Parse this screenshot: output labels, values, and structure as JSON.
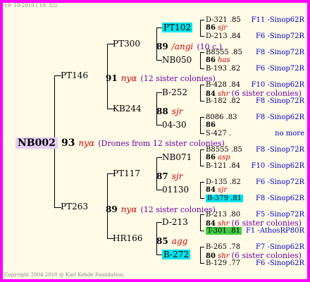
{
  "header": {
    "date": "19- 10-2010 ( 10: 32)"
  },
  "footer": {
    "copyright": "Copyright 2004-2010 @ Karl Kehde Foundation."
  },
  "root": {
    "id": "NB002",
    "gen": "93",
    "race": "nyα",
    "note": "(Drones from 12 sister colonies)"
  },
  "mother": {
    "id": "PT146",
    "gen": "91",
    "race": "nyα",
    "note": "(12 sister colonies)",
    "pt300": {
      "id": "PT300",
      "gen": "89",
      "race": "/angi",
      "note": "(10 c.)",
      "pt102": "PT102",
      "nb050": "NB050",
      "pt102_s": {
        "gen": "86",
        "race": "sjr"
      },
      "nb050_s": {
        "gen": "86",
        "race": "has"
      }
    },
    "kb244": {
      "id": "KB244",
      "gen": "88",
      "race": "sjr",
      "b252": "B-252",
      "n0430": "04-30",
      "b252_s": {
        "gen": "84",
        "race": "shr",
        "note": "(6 sister colonies)"
      },
      "n0430_s": {
        "gen": "86"
      }
    }
  },
  "father": {
    "id": "PT263",
    "gen": "89",
    "race": "nyα",
    "note": "(12 sister colonies)",
    "pt117": {
      "id": "PT117",
      "gen": "87",
      "race": "sjr",
      "nb071": "NB071",
      "n01130": "01130",
      "nb071_s": {
        "gen": "86",
        "race": "asp"
      },
      "n01130_s": {
        "gen": "84",
        "race": "sjr"
      }
    },
    "hr166": {
      "id": "HR166",
      "gen": "85",
      "race": "agg",
      "d213": "D-213",
      "b272": "B-272",
      "d213_s": {
        "gen": "84",
        "race": "shr",
        "note": "(6 sister colonies)"
      },
      "b272_s": {
        "gen": "80",
        "race": "shr",
        "note": "(6 sister colonies)"
      }
    }
  },
  "right_entries": [
    {
      "id": "D-321",
      "gen": ".85",
      "source": "F11 -Sinop62R",
      "hl": ""
    },
    {
      "id": "D-213",
      "gen": ".84",
      "source": "F6 -Sinop72R",
      "hl": ""
    },
    {
      "id": "B8555",
      "gen": ".85",
      "source": "F8 -Sinop72R",
      "hl": ""
    },
    {
      "id": "B-193",
      "gen": ".82",
      "source": "F6 -Sinop72R",
      "hl": ""
    },
    {
      "id": "B-428",
      "gen": ".84",
      "source": "F10 -Sinop62R",
      "hl": ""
    },
    {
      "id": "B-182",
      "gen": ".82",
      "source": "F8 -Sinop72R",
      "hl": ""
    },
    {
      "id": "8086",
      "gen": ".83",
      "source": "F8 -Sinop62R",
      "hl": ""
    },
    {
      "id": "S-427",
      "gen": ".",
      "source": "no more",
      "hl": ""
    },
    {
      "id": "B8555",
      "gen": ".85",
      "source": "F8 -Sinop72R",
      "hl": ""
    },
    {
      "id": "B-121",
      "gen": ".84",
      "source": "F10 -Sinop62R",
      "hl": ""
    },
    {
      "id": "D-135",
      "gen": ".82",
      "source": "F6 -Sinop72R",
      "hl": ""
    },
    {
      "id": "B-379",
      "gen": ".81",
      "source": "F8 -Sinop62R",
      "hl": "cyan"
    },
    {
      "id": "B-213",
      "gen": ".80",
      "source": "F5 -Sinop72R",
      "hl": ""
    },
    {
      "id": "T-301",
      "gen": ".81",
      "source": "F1 -AthosRP80R",
      "hl": "green"
    },
    {
      "id": "B-265",
      "gen": ".78",
      "source": "F7 -Sinop62R",
      "hl": ""
    },
    {
      "id": "B-129",
      "gen": ".77",
      "source": "F6 -Sinop62R",
      "hl": ""
    }
  ],
  "colors": {
    "border": "#ff00ff",
    "background": "#fffbe6",
    "highlight_cyan": "#00e5ee",
    "highlight_green": "#44cc44",
    "race": "#cc0000",
    "source": "#0000cc"
  }
}
